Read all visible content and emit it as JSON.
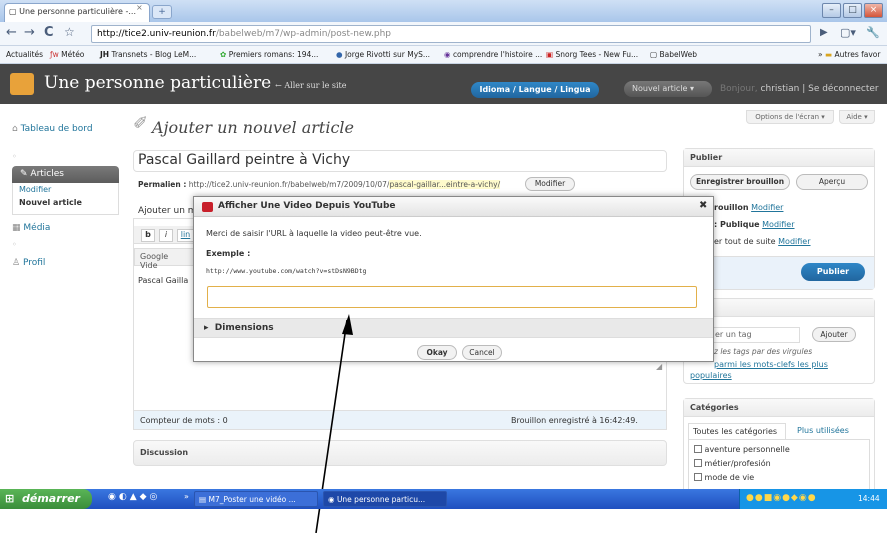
{
  "browser": {
    "tab_title": "Une personne particulière -...",
    "url_host": "http://tice2.univ-reunion.fr",
    "url_path": "/babelweb/m7/wp-admin/post-new.php",
    "bookmarks": [
      "Actualités",
      "Météo",
      "Transnets - Blog LeM...",
      "Premiers romans: 194...",
      "Jorge Rivotti sur MyS...",
      "comprendre l'histoire ...",
      "Snorg Tees - New Fu...",
      "BabelWeb"
    ],
    "other_bookmarks": "Autres favor"
  },
  "wp_header": {
    "site_title": "Une personne particulière",
    "visit_site": "← Aller sur le site",
    "lang_button": "Idioma / Langue / Lingua",
    "new_post_button": "Nouvel article",
    "howdy": "Bonjour,",
    "user": "christian",
    "logout": "Se déconnecter"
  },
  "sidebar": {
    "dashboard": "Tableau de bord",
    "posts": "Articles",
    "posts_sub": [
      "Modifier",
      "Nouvel article"
    ],
    "media": "Média",
    "profile": "Profil"
  },
  "main": {
    "page_title": "Ajouter un nouvel article",
    "screen_options": "Options de l'écran ▾",
    "help": "Aide ▾",
    "post_title": "Pascal Gaillard peintre à Vichy",
    "permalink_label": "Permalien :",
    "permalink_url": "http://tice2.univ-reunion.fr/babelweb/m7/2009/10/07/",
    "permalink_slug": "pascal-gaillar...eintre-a-vichy/",
    "permalink_edit": "Modifier",
    "add_media": "Ajouter un m",
    "toolbar_b": "b",
    "toolbar_i": "i",
    "toolbar_link": "lin",
    "google_tab": "Google Vide",
    "content_text": "Pascal Gailla",
    "word_count": "Compteur de mots : 0",
    "draft_saved": "Brouillon enregistré à 16:42:49.",
    "discussion": "Discussion"
  },
  "publish": {
    "title": "Publier",
    "save_draft": "Enregistrer brouillon",
    "preview": "Aperçu",
    "status": "rouillon",
    "status_edit": "Modifier",
    "visibility": ": Publique",
    "visibility_edit": "Modifier",
    "schedule": "er tout de suite",
    "schedule_edit": "Modifier",
    "publish_button": "Publier"
  },
  "tags": {
    "placeholder": "er un tag",
    "add_button": "Ajouter",
    "hint": "z les tags par des virgules",
    "choose_line1": "parmi les mots-clefs les plus",
    "choose_line2": "populaires"
  },
  "categories": {
    "title": "Catégories",
    "tab_all": "Toutes les catégories",
    "tab_used": "Plus utilisées",
    "items": [
      "aventure personnelle",
      "métier/profesión",
      "mode de vie"
    ]
  },
  "modal": {
    "title": "Afficher Une Video Depuis YouTube",
    "instruction": "Merci de saisir l'URL à laquelle la video peut-être vue.",
    "example_label": "Exemple :",
    "example_url": "http://www.youtube.com/watch?v=stDsN9BDtg",
    "url_value": "",
    "dimensions": "Dimensions",
    "okay": "Okay",
    "cancel": "Cancel"
  },
  "taskbar": {
    "start": "démarrer",
    "items": [
      "M7_Poster une vidéo ...",
      "Une personne particu..."
    ],
    "clock": "14:44"
  }
}
